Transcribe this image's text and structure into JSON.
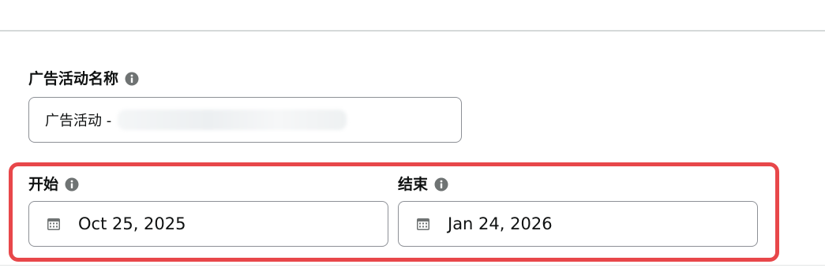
{
  "campaign_name": {
    "label": "广告活动名称",
    "value_prefix": "广告活动 - ",
    "icon": "info-icon"
  },
  "date_range": {
    "start": {
      "label": "开始",
      "value": "Oct 25, 2025",
      "icon": "calendar-icon"
    },
    "end": {
      "label": "结束",
      "value": "Jan 24, 2026",
      "icon": "calendar-icon"
    }
  },
  "colors": {
    "highlight": "#e8474a",
    "border": "#8d9096",
    "info_icon": "#6f7373"
  }
}
